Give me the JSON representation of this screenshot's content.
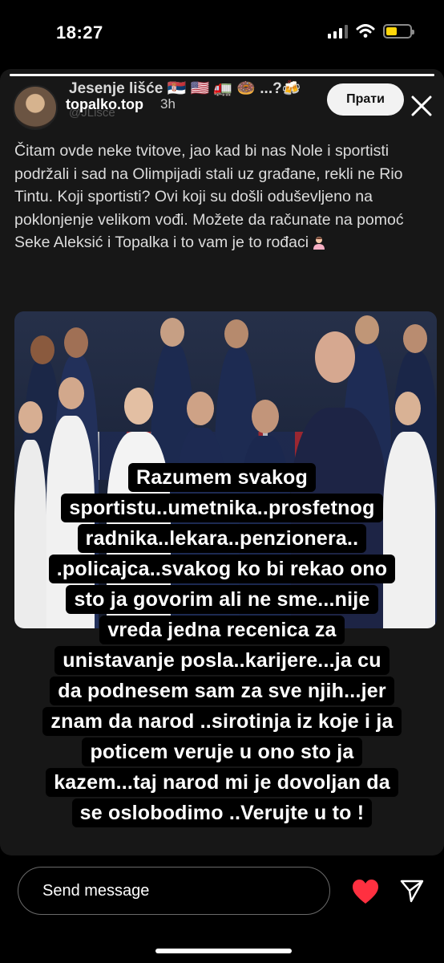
{
  "status_bar": {
    "time": "18:27"
  },
  "story": {
    "progress": 1.0,
    "username": "topalko.top",
    "time_ago": "3h",
    "follow_label": "Прати",
    "tweet": {
      "author_name": "Jesenje lišće 🇷🇸 🇺🇸 🚛 🍩 ...?🍻",
      "author_handle": "@JLisce",
      "text": "Čitam ovde neke tvitove, jao kad bi nas Nole i sportisti podržali i sad na Olimpijadi stali uz građane, rekli ne Rio Tintu. Koji sportisti? Ovi koji su došli oduševljeno na poklonjenje velikom vođi. Možete da računate na pomoć Seke Aleksić i Topalka i to vam je to rođaci"
    },
    "caption_lines": [
      "Razumem svakog",
      "sportistu..umetnika..prosfetnog",
      "radnika..lekara..penzionera..",
      ".policajca..svakog ko bi rekao ono",
      "sto ja govorim ali ne sme...nije",
      "vreda jedna recenica za",
      "unistavanje posla..karijere...ja cu",
      "da podnesem sam za sve njih...jer",
      "znam da narod ..sirotinja iz koje i ja",
      "poticem veruje u ono sto ja",
      "kazem...taj narod mi je dovoljan da",
      "se oslobodimo ..Verujte u to !"
    ]
  },
  "reply": {
    "placeholder": "Send message"
  },
  "colors": {
    "heart": "#ff3040",
    "battery": "#ffd60a",
    "background": "#000000",
    "card": "#171717"
  },
  "icons": [
    "signal-icon",
    "wifi-icon",
    "battery-icon",
    "close-icon",
    "heart-icon",
    "send-icon"
  ]
}
